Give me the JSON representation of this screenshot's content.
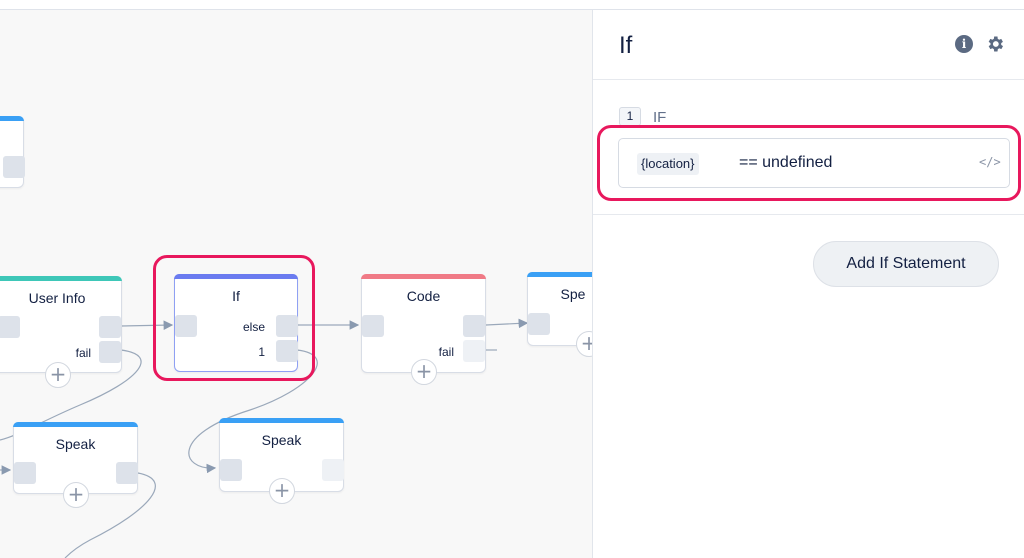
{
  "canvas": {
    "nodes": {
      "partial_top": {},
      "user_info": {
        "title": "User Info",
        "fail": "fail",
        "accent": "#3ec7b8"
      },
      "if": {
        "title": "If",
        "else": "else",
        "one": "1",
        "accent": "#6b7cf0"
      },
      "code": {
        "title": "Code",
        "fail": "fail",
        "accent": "#f07a86"
      },
      "speak_right": {
        "title": "Spe",
        "accent": "#3aa0f5"
      },
      "speak_left": {
        "title": "Speak",
        "accent": "#3aa0f5"
      },
      "speak_mid": {
        "title": "Speak",
        "accent": "#3aa0f5"
      }
    },
    "plus_symbol": "+",
    "highlight_color": "#e8185d"
  },
  "panel": {
    "title": "If",
    "info_icon": "info-icon",
    "info_glyph": "i",
    "settings_icon": "gear-icon",
    "condition": {
      "number": "1",
      "label": "IF",
      "variable": "{location}",
      "expression": "== undefined",
      "code_toggle": "</>"
    },
    "add_button": "Add If Statement"
  }
}
